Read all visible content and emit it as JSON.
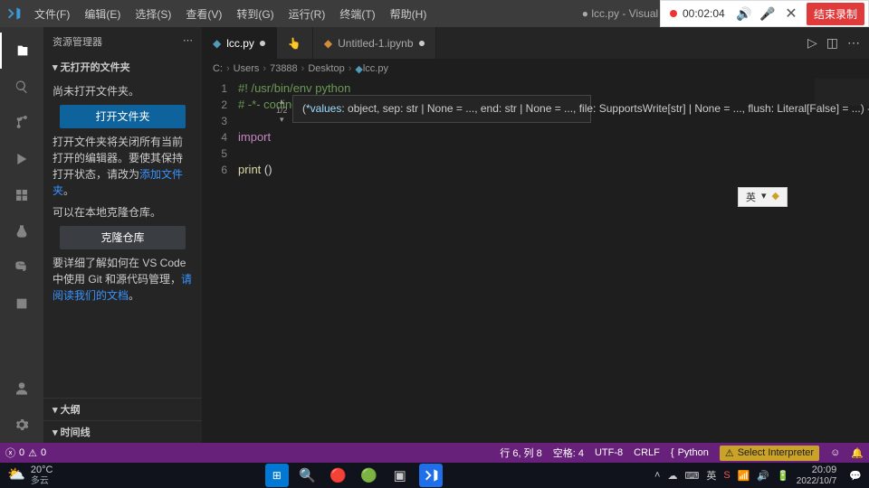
{
  "menu": {
    "file": "文件(F)",
    "edit": "编辑(E)",
    "select": "选择(S)",
    "view": "查看(V)",
    "goto": "转到(G)",
    "run": "运行(R)",
    "terminal": "终端(T)",
    "help": "帮助(H)"
  },
  "window_title": "● lcc.py - Visual Studio Code",
  "recording": {
    "time": "00:02:04",
    "stop_label": "结束录制"
  },
  "explorer": {
    "title": "资源管理器",
    "section1": "无打开的文件夹",
    "line1": "尚未打开文件夹。",
    "open_btn": "打开文件夹",
    "line2a": "打开文件夹将关闭所有当前打开的编辑器。要使其保持打开状态，请改为",
    "line2b": "添加文件夹",
    "line3": "可以在本地克隆仓库。",
    "clone_btn": "克隆仓库",
    "line4a": "要详细了解如何在 VS Code 中使用 Git 和源代码管理，",
    "line4b": "请阅读我们的文档",
    "outline": "大纲",
    "timeline": "时间线"
  },
  "tabs": {
    "t1": "lcc.py",
    "t2": "Untitled-1.ipynb"
  },
  "crumbs": [
    "C:",
    "Users",
    "73888",
    "Desktop",
    "lcc.py"
  ],
  "code": {
    "l1": "#! /usr/bin/env python",
    "l2": "# -*- coding: UTF-8 -*-",
    "l4": "import ",
    "l6a": "print ",
    "l6b": "()",
    "tooltip": "(*values: object, sep: str | None = ..., end: str | None = ..., file: SupportsWrite[str] | None = ..., flush: Literal[False] = ...) -> None",
    "tt_index": "1/2"
  },
  "ime": {
    "a": "英",
    "b": "▾",
    "c": "◆"
  },
  "status": {
    "errors": "0",
    "warnings": "0",
    "ln_col": "行 6, 列 8",
    "spaces": "空格: 4",
    "enc": "UTF-8",
    "eol": "CRLF",
    "lang": "Python",
    "interp": "Select Interpreter"
  },
  "taskbar": {
    "temp": "20°C",
    "weather": "多云",
    "tray_lang": "英",
    "time": "20:09",
    "date": "2022/10/7"
  }
}
